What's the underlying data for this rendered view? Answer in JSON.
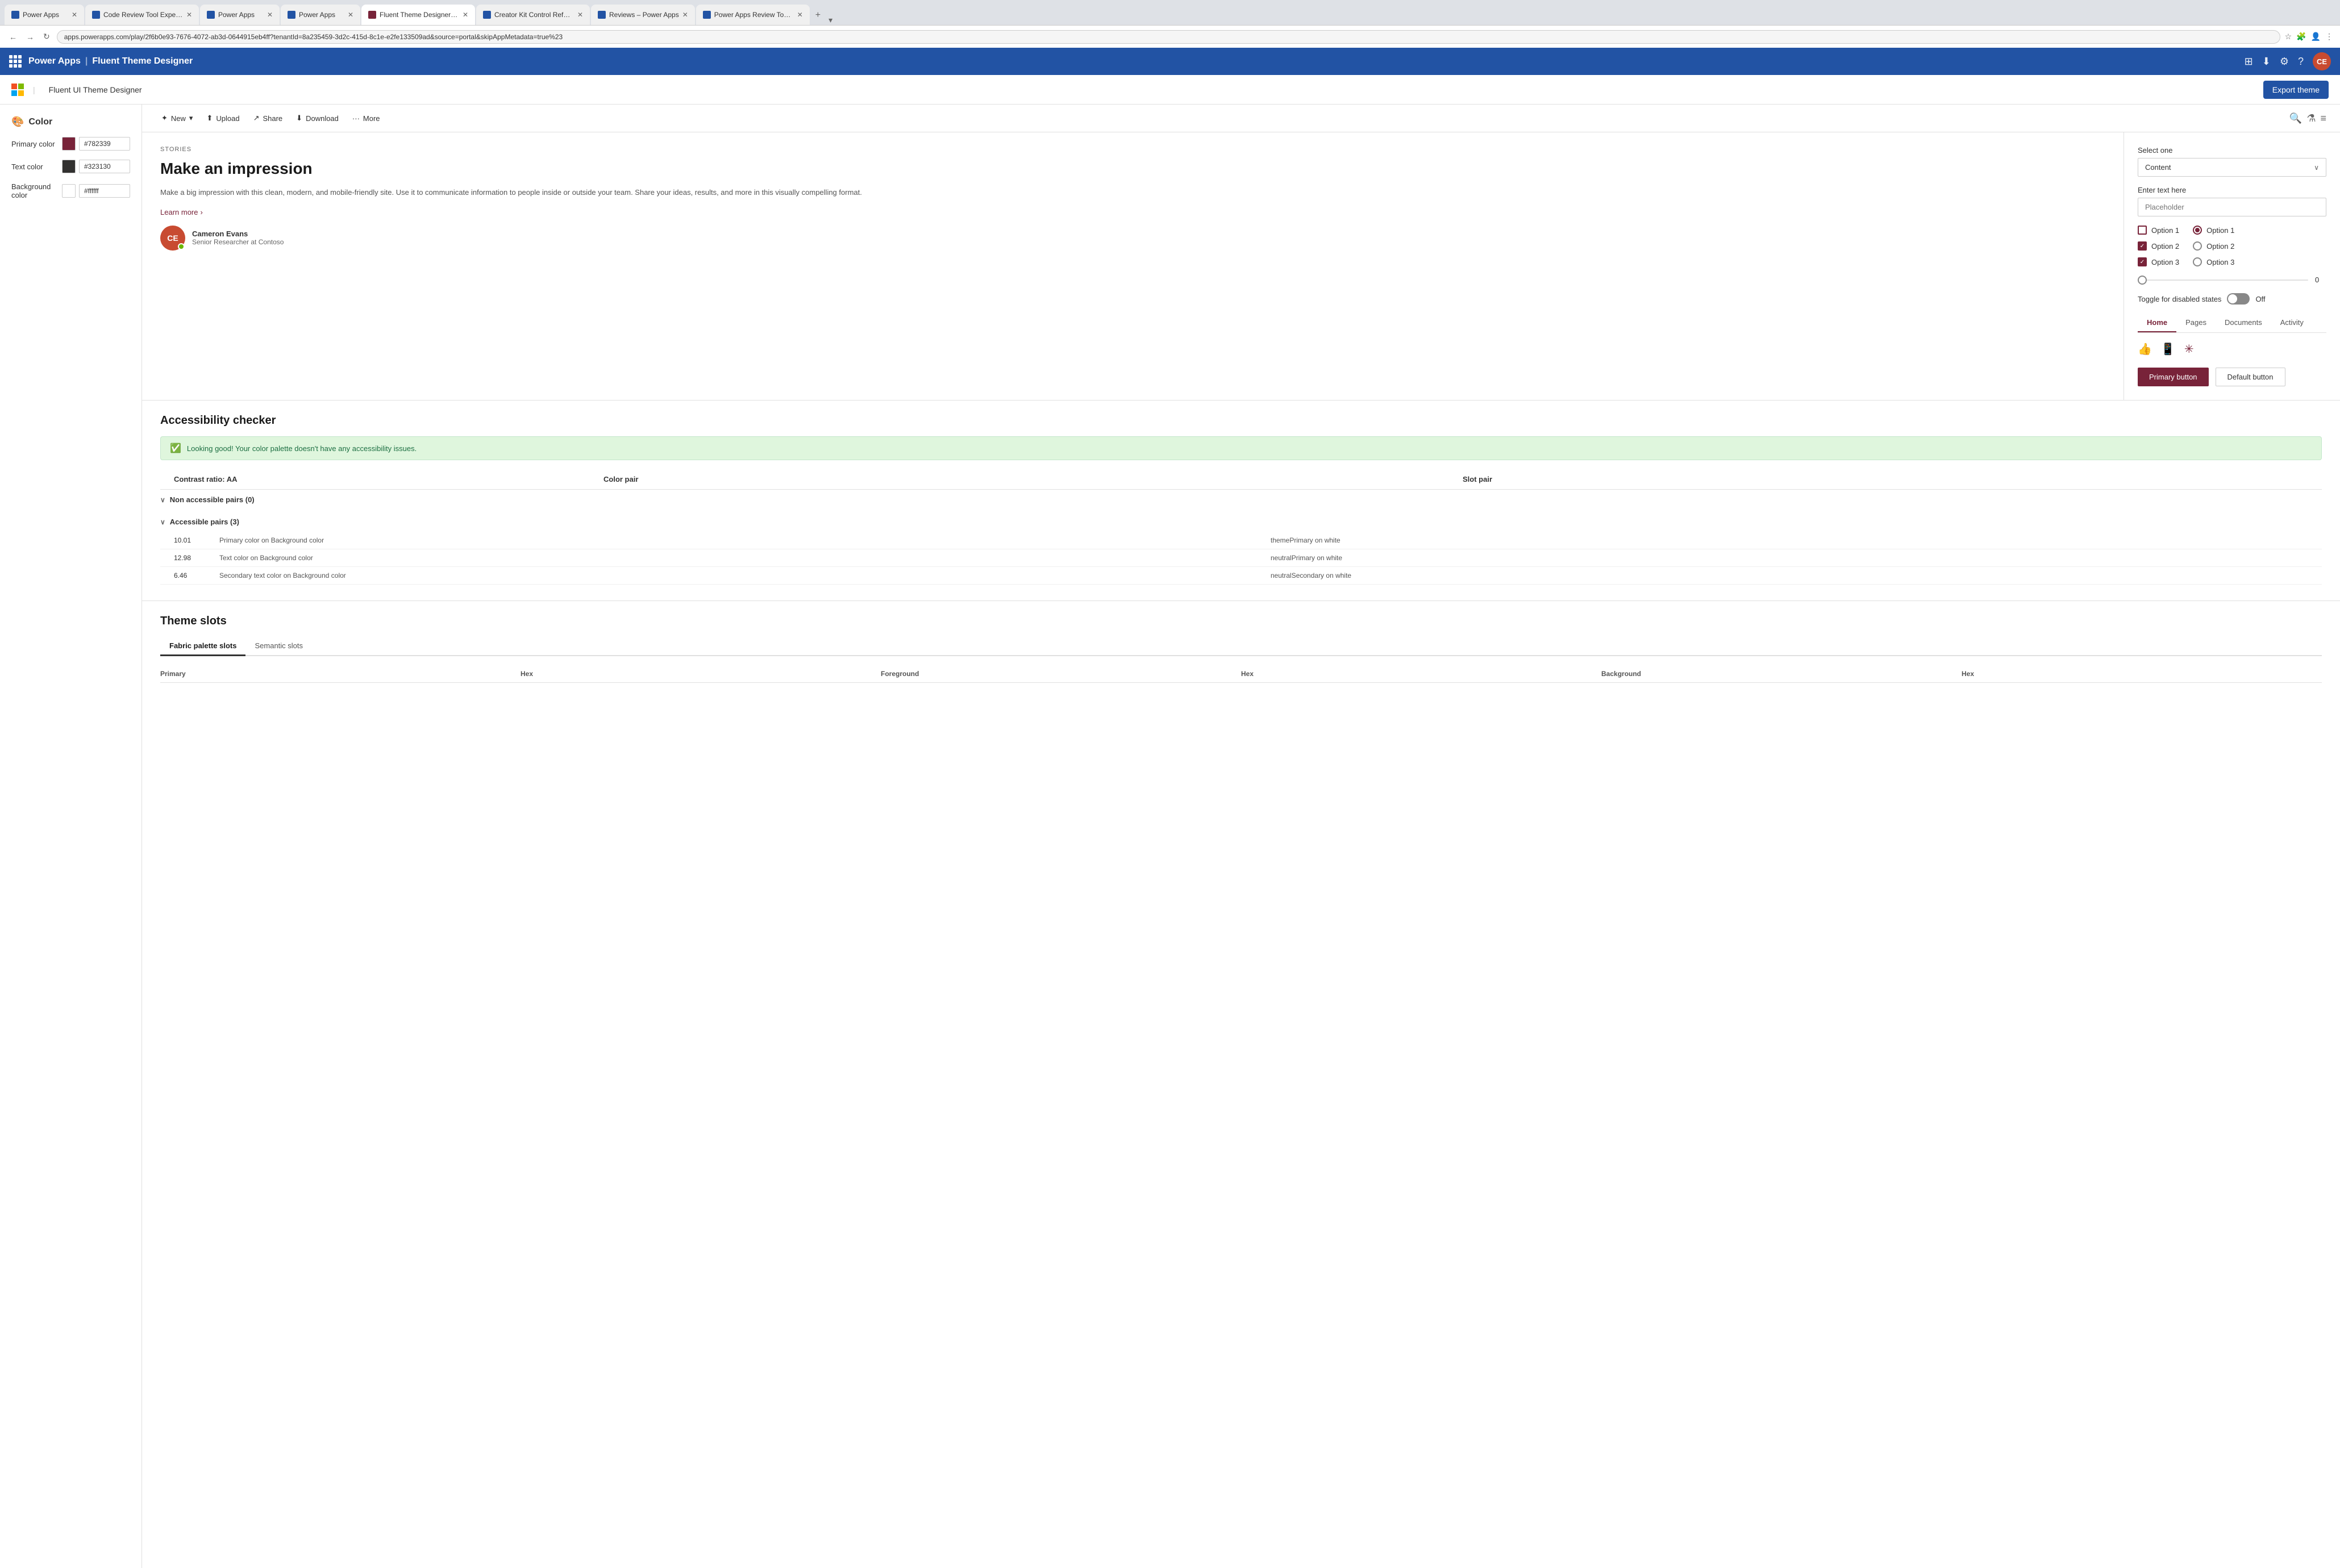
{
  "browser": {
    "tabs": [
      {
        "label": "Power Apps",
        "favicon_color": "#2253a4",
        "active": false
      },
      {
        "label": "Code Review Tool Experim...",
        "favicon_color": "#2253a4",
        "active": false
      },
      {
        "label": "Power Apps",
        "favicon_color": "#2253a4",
        "active": false
      },
      {
        "label": "Power Apps",
        "favicon_color": "#2253a4",
        "active": false
      },
      {
        "label": "Fluent Theme Designer -...",
        "favicon_color": "#782339",
        "active": true
      },
      {
        "label": "Creator Kit Control Refere...",
        "favicon_color": "#2253a4",
        "active": false
      },
      {
        "label": "Reviews – Power Apps",
        "favicon_color": "#2253a4",
        "active": false
      },
      {
        "label": "Power Apps Review Tool ...",
        "favicon_color": "#2253a4",
        "active": false
      }
    ],
    "url": "apps.powerapps.com/play/2f6b0e93-7676-4072-ab3d-0644915eb4ff?tenantId=8a235459-3d2c-415d-8c1e-e2fe133509ad&source=portal&skipAppMetadata=true%23"
  },
  "app_header": {
    "app_name": "Power Apps",
    "separator": "|",
    "page_title": "Fluent Theme Designer",
    "waffle_label": "waffle menu"
  },
  "sub_header": {
    "logo_label": "Microsoft logo",
    "title": "Fluent UI Theme Designer",
    "export_button": "Export theme"
  },
  "sidebar": {
    "section_title": "Color",
    "colors": [
      {
        "label": "Primary color",
        "hex": "#782339",
        "input_value": "#782339"
      },
      {
        "label": "Text color",
        "hex": "#323130",
        "input_value": "#323130"
      },
      {
        "label": "Background color",
        "hex": "#ffffff",
        "input_value": "#ffffff"
      }
    ]
  },
  "toolbar": {
    "new_label": "New",
    "upload_label": "Upload",
    "share_label": "Share",
    "download_label": "Download",
    "more_label": "More"
  },
  "preview": {
    "stories_label": "STORIES",
    "title": "Make an impression",
    "description": "Make a big impression with this clean, modern, and mobile-friendly site. Use it to communicate information to people inside or outside your team. Share your ideas, results, and more in this visually compelling format.",
    "learn_more": "Learn more",
    "person": {
      "initials": "CE",
      "name": "Cameron Evans",
      "role": "Senior Researcher at Contoso"
    },
    "form": {
      "select_label": "Select one",
      "select_value": "Content",
      "text_label": "Enter text here",
      "text_placeholder": "Placeholder"
    },
    "checkboxes": [
      {
        "label": "Option 1",
        "checked": false
      },
      {
        "label": "Option 2",
        "checked": true
      },
      {
        "label": "Option 3",
        "checked": true
      }
    ],
    "radios": [
      {
        "label": "Option 1",
        "checked": true
      },
      {
        "label": "Option 2",
        "checked": false
      },
      {
        "label": "Option 3",
        "checked": false
      }
    ],
    "slider_value": "0",
    "toggle": {
      "label": "Toggle for disabled states",
      "state_label": "Off"
    },
    "tabs": [
      {
        "label": "Home",
        "active": true
      },
      {
        "label": "Pages",
        "active": false
      },
      {
        "label": "Documents",
        "active": false
      },
      {
        "label": "Activity",
        "active": false
      }
    ],
    "primary_button": "Primary button",
    "default_button": "Default button"
  },
  "accessibility": {
    "title": "Accessibility checker",
    "success_message": "Looking good! Your color palette doesn't have any accessibility issues.",
    "table_headers": {
      "contrast_ratio": "Contrast ratio: AA",
      "color_pair": "Color pair",
      "slot_pair": "Slot pair"
    },
    "groups": [
      {
        "label": "Non accessible pairs (0)",
        "expanded": true,
        "rows": []
      },
      {
        "label": "Accessible pairs (3)",
        "expanded": true,
        "rows": [
          {
            "ratio": "10.01",
            "pair": "Primary color on Background color",
            "slot": "themePrimary on white"
          },
          {
            "ratio": "12.98",
            "pair": "Text color on Background color",
            "slot": "neutralPrimary on white"
          },
          {
            "ratio": "6.46",
            "pair": "Secondary text color on Background color",
            "slot": "neutralSecondary on white"
          }
        ]
      }
    ]
  },
  "theme_slots": {
    "title": "Theme slots",
    "tabs": [
      {
        "label": "Fabric palette slots",
        "active": true
      },
      {
        "label": "Semantic slots",
        "active": false
      }
    ],
    "headers": [
      "Primary",
      "Hex",
      "Foreground",
      "Hex",
      "Background",
      "Hex"
    ]
  }
}
